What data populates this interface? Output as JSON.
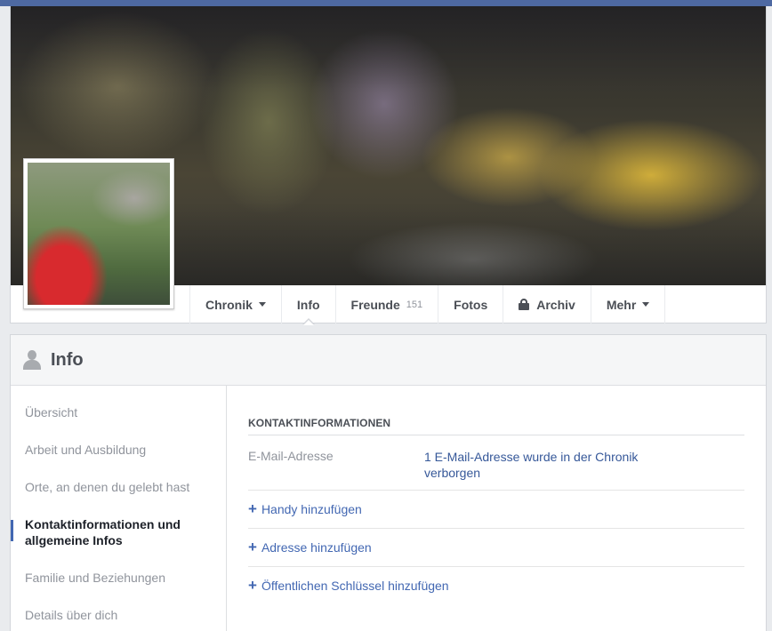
{
  "tabs": {
    "chronik": "Chronik",
    "info": "Info",
    "freunde": "Freunde",
    "freunde_count": "151",
    "fotos": "Fotos",
    "archiv": "Archiv",
    "mehr": "Mehr"
  },
  "panel": {
    "title": "Info"
  },
  "leftnav": {
    "items": [
      "Übersicht",
      "Arbeit und Ausbildung",
      "Orte, an denen du gelebt hast",
      "Kontaktinformationen und allgemeine Infos",
      "Familie und Beziehungen",
      "Details über dich"
    ],
    "active_index": 3
  },
  "contact": {
    "section_title": "KONTAKTINFORMATIONEN",
    "email_label": "E-Mail-Adresse",
    "email_value": "1 E-Mail-Adresse wurde in der Chronik verborgen",
    "add_phone": "Handy hinzufügen",
    "add_address": "Adresse hinzufügen",
    "add_key": "Öffentlichen Schlüssel hinzufügen"
  },
  "colors": {
    "topbar": "#4e69a2",
    "link": "#4267b2",
    "active_marker": "#4267b2"
  },
  "icons": {
    "chronik_caret": "chevron-down-icon",
    "archiv": "lock-icon",
    "mehr_caret": "chevron-down-icon",
    "panel": "person-icon",
    "add": "plus-icon"
  }
}
